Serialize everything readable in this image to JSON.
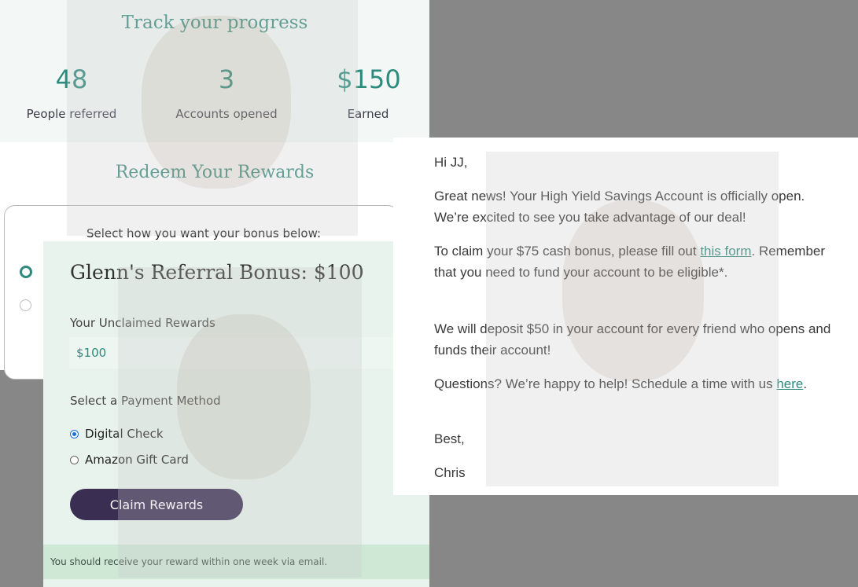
{
  "progress": {
    "title": "Track your progress",
    "stats": [
      {
        "value": "48",
        "label": "People referred"
      },
      {
        "value": "3",
        "label": "Accounts opened"
      },
      {
        "value": "$150",
        "label": "Earned"
      }
    ]
  },
  "redeem": {
    "title": "Redeem Your Rewards",
    "instruction": "Select how you want your bonus below:"
  },
  "bonus": {
    "title": "Glenn's Referral Bonus: $100",
    "unclaimed_label": "Your Unclaimed Rewards",
    "unclaimed_value": "$100",
    "payment_label": "Select a Payment Method",
    "options": [
      {
        "label": "Digital Check",
        "selected": true
      },
      {
        "label": "Amazon Gift Card",
        "selected": false
      }
    ],
    "claim_button": "Claim Rewards",
    "notice": "You should receive your reward within one week via email."
  },
  "email": {
    "greeting": "Hi JJ,",
    "para1": "Great news! Your High Yield Savings Account is officially open. We’re excited to see you take advantage of our deal!",
    "para2_pre": "To claim your $75 cash bonus, please fill out ",
    "para2_link": "this form",
    "para2_post": ". Remember that you need to fund your account to be eligible*.",
    "para3": "We will deposit $50 in your account for every friend who opens and funds their account!",
    "para4_pre": "Questions? We’re happy to help! Schedule a time with us ",
    "para4_link": "here",
    "para4_post": ".",
    "signoff": "Best,",
    "signature": "Chris"
  },
  "colors": {
    "accent": "#2e8a7c",
    "button": "#3a2f52",
    "notice": "#cfe8d6",
    "radio_selected": "#1a6fd8"
  }
}
